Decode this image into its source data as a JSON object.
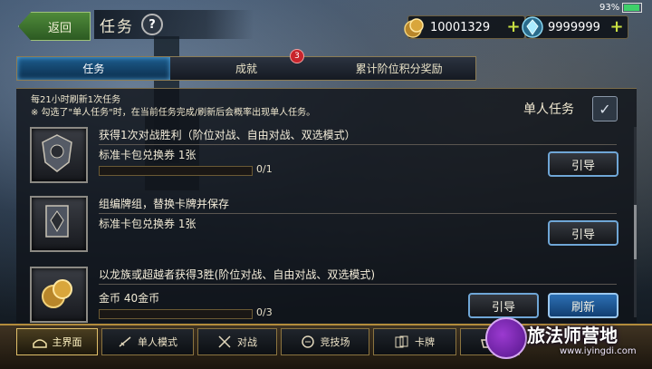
{
  "status": {
    "battery": "93"
  },
  "header": {
    "back_label": "返回",
    "title": "任务",
    "help_symbol": "?"
  },
  "currency": {
    "gold": {
      "value": "10001329",
      "icon": "gold-coins-icon"
    },
    "gems": {
      "value": "9999999",
      "icon": "crystal-icon"
    }
  },
  "tabs": [
    {
      "label": "任务",
      "active": true
    },
    {
      "label": "成就",
      "badge": "3"
    },
    {
      "label": "累计阶位积分奖励"
    }
  ],
  "panel": {
    "refresh_note": "每21小时刷新1次任务",
    "solo_note": "※ 勾选了\"单人任务\"时，在当前任务完成/刷新后会概率出现单人任务。",
    "solo_label": "单人任务",
    "solo_checked": true
  },
  "quests": [
    {
      "title": "获得1次对战胜利（阶位对战、自由对战、双选模式）",
      "reward": "标准卡包兑换券 1张",
      "progress": "0/1",
      "progress_fraction": 0.0,
      "guide": "引导"
    },
    {
      "title": "组编牌组，替换卡牌并保存",
      "reward": "标准卡包兑换券 1张",
      "guide": "引导"
    },
    {
      "title": "以龙族或超越者获得3胜(阶位对战、自由对战、双选模式)",
      "reward": "金币 40金币",
      "progress": "0/3",
      "progress_fraction": 0.0,
      "guide": "引导",
      "refresh": "刷新"
    }
  ],
  "bottom_nav": [
    {
      "label": "主界面",
      "icon": "home-icon",
      "active": true
    },
    {
      "label": "单人模式",
      "icon": "sword-icon"
    },
    {
      "label": "对战",
      "icon": "crossed-swords-icon"
    },
    {
      "label": "竞技场",
      "icon": "arena-icon"
    },
    {
      "label": "卡牌",
      "icon": "cards-icon"
    },
    {
      "label": "",
      "icon": "shop-icon"
    }
  ],
  "watermark": {
    "text": "旅法师营地",
    "url": "www.iyingdi.com"
  }
}
